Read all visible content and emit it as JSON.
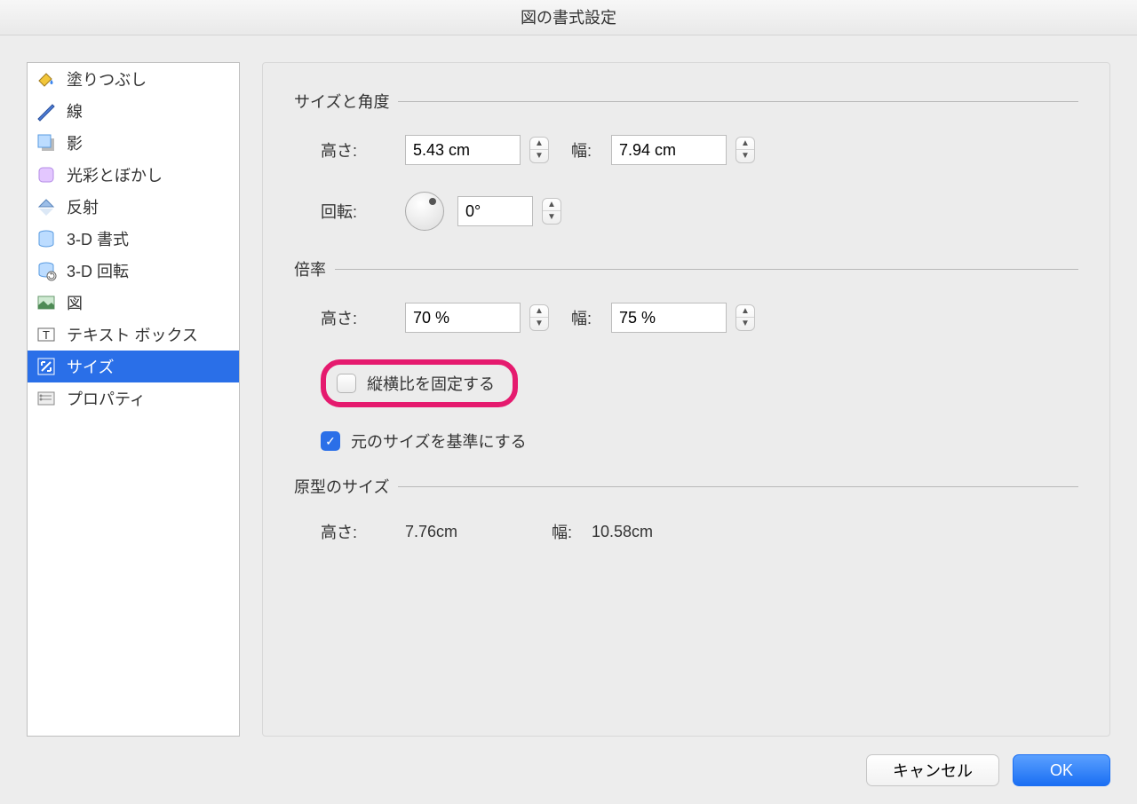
{
  "window": {
    "title": "図の書式設定"
  },
  "sidebar": {
    "items": [
      {
        "label": "塗りつぶし"
      },
      {
        "label": "線"
      },
      {
        "label": "影"
      },
      {
        "label": "光彩とぼかし"
      },
      {
        "label": "反射"
      },
      {
        "label": "3-D 書式"
      },
      {
        "label": "3-D 回転"
      },
      {
        "label": "図"
      },
      {
        "label": "テキスト ボックス"
      },
      {
        "label": "サイズ"
      },
      {
        "label": "プロパティ"
      }
    ],
    "selectedIndex": 9
  },
  "main": {
    "section_size": {
      "title": "サイズと角度",
      "height_label": "高さ:",
      "height_value": "5.43 cm",
      "width_label": "幅:",
      "width_value": "7.94 cm",
      "rotation_label": "回転:",
      "rotation_value": "0°"
    },
    "section_scale": {
      "title": "倍率",
      "height_label": "高さ:",
      "height_value": "70 %",
      "width_label": "幅:",
      "width_value": "75 %",
      "lock_aspect_label": "縦横比を固定する",
      "lock_aspect_checked": false,
      "relative_original_label": "元のサイズを基準にする",
      "relative_original_checked": true
    },
    "section_original": {
      "title": "原型のサイズ",
      "height_label": "高さ:",
      "height_value": "7.76cm",
      "width_label": "幅:",
      "width_value": "10.58cm"
    }
  },
  "footer": {
    "cancel": "キャンセル",
    "ok": "OK"
  }
}
